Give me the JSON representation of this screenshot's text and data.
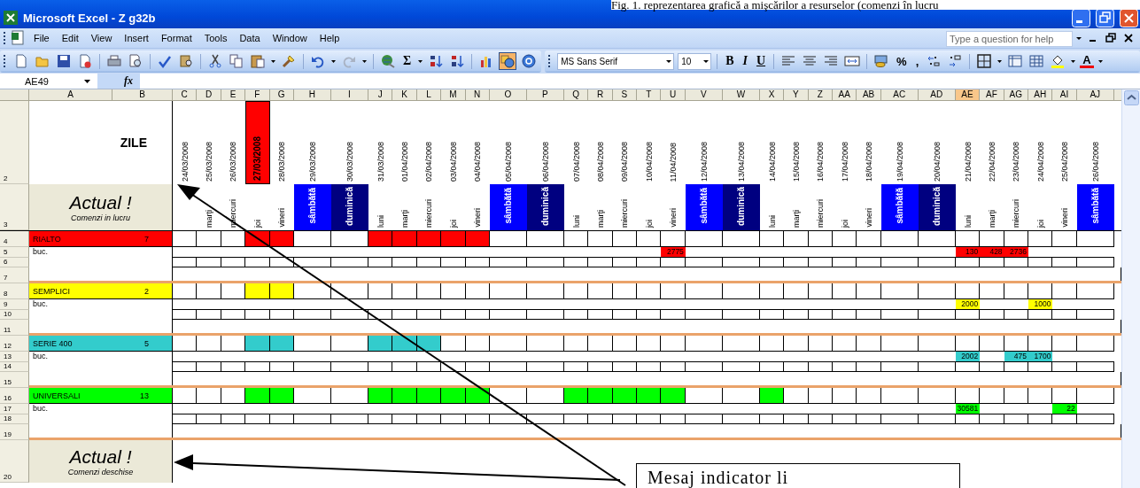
{
  "caption": "Fig. 1. reprezentarea grafică a  mişcărilor a resurselor (comenzi în lucru",
  "window": {
    "title": "Microsoft Excel - Z g32b"
  },
  "menu": [
    {
      "label": "File",
      "selected": false
    },
    {
      "label": "Edit",
      "selected": false
    },
    {
      "label": "View",
      "selected": false
    },
    {
      "label": "Insert",
      "selected": false
    },
    {
      "label": "Format",
      "selected": false
    },
    {
      "label": "Tools",
      "selected": false
    },
    {
      "label": "Data",
      "selected": false
    },
    {
      "label": "Window",
      "selected": false
    },
    {
      "label": "Help",
      "selected": false
    }
  ],
  "help_box": {
    "placeholder": "Type a question for help"
  },
  "toolbar": {
    "sum": "Σ",
    "bold": "B",
    "italic": "I",
    "underline": "U",
    "percent": "%",
    "comma": ",",
    "font_color": "A",
    "drawing_on": true
  },
  "font_box": {
    "value": "MS Sans Serif"
  },
  "size_box": {
    "value": "10"
  },
  "name_box": {
    "value": "AE49"
  },
  "formula_bar": {
    "label": "fx"
  },
  "columns": [
    {
      "label": "A",
      "selected": false
    },
    {
      "label": "B",
      "selected": false
    },
    {
      "label": "C",
      "selected": false
    },
    {
      "label": "D",
      "selected": false
    },
    {
      "label": "E",
      "selected": false
    },
    {
      "label": "F",
      "selected": false
    },
    {
      "label": "G",
      "selected": false
    },
    {
      "label": "H",
      "selected": false
    },
    {
      "label": "I",
      "selected": false
    },
    {
      "label": "J",
      "selected": false
    },
    {
      "label": "K",
      "selected": false
    },
    {
      "label": "L",
      "selected": false
    },
    {
      "label": "M",
      "selected": false
    },
    {
      "label": "N",
      "selected": false
    },
    {
      "label": "O",
      "selected": false
    },
    {
      "label": "P",
      "selected": false
    },
    {
      "label": "Q",
      "selected": false
    },
    {
      "label": "R",
      "selected": false
    },
    {
      "label": "S",
      "selected": false
    },
    {
      "label": "T",
      "selected": false
    },
    {
      "label": "U",
      "selected": false
    },
    {
      "label": "V",
      "selected": false
    },
    {
      "label": "W",
      "selected": false
    },
    {
      "label": "X",
      "selected": false
    },
    {
      "label": "Y",
      "selected": false
    },
    {
      "label": "Z",
      "selected": false
    },
    {
      "label": "AA",
      "selected": false
    },
    {
      "label": "AB",
      "selected": false
    },
    {
      "label": "AC",
      "selected": false
    },
    {
      "label": "AD",
      "selected": false
    },
    {
      "label": "AE",
      "selected": true
    },
    {
      "label": "AF",
      "selected": false
    },
    {
      "label": "AG",
      "selected": false
    },
    {
      "label": "AH",
      "selected": false
    },
    {
      "label": "AI",
      "selected": false
    },
    {
      "label": "AJ",
      "selected": false
    }
  ],
  "header": {
    "row_2": "2",
    "row_3": "3",
    "days_label": "ZILE",
    "title": "Actual !",
    "subtitle": "Comenzi in lucru"
  },
  "days": [
    {
      "date": "24/03/2008",
      "kind": "weekday",
      "today": false
    },
    {
      "date": "25/03/2008",
      "day": "marţi",
      "kind": "weekday",
      "today": false
    },
    {
      "date": "26/03/2008",
      "day": "miercuri",
      "kind": "weekday",
      "today": false
    },
    {
      "date": "27/03/2008",
      "day": "joi",
      "kind": "weekday",
      "today": true
    },
    {
      "date": "28/03/2008",
      "day": "vineri",
      "kind": "weekday",
      "today": false
    },
    {
      "date": "29/03/2008",
      "day": "sâmbătă",
      "kind": "saturday",
      "today": false
    },
    {
      "date": "30/03/2008",
      "day": "duminică",
      "kind": "sunday",
      "today": false
    },
    {
      "date": "31/03/2008",
      "day": "luni",
      "kind": "weekday",
      "today": false
    },
    {
      "date": "01/04/2008",
      "day": "marţi",
      "kind": "weekday",
      "today": false
    },
    {
      "date": "02/04/2008",
      "day": "miercuri",
      "kind": "weekday",
      "today": false
    },
    {
      "date": "03/04/2008",
      "day": "joi",
      "kind": "weekday",
      "today": false
    },
    {
      "date": "04/04/2008",
      "day": "vineri",
      "kind": "weekday",
      "today": false
    },
    {
      "date": "05/04/2008",
      "day": "sâmbătă",
      "kind": "saturday",
      "today": false
    },
    {
      "date": "06/04/2008",
      "day": "duminică",
      "kind": "sunday",
      "today": false
    },
    {
      "date": "07/04/2008",
      "day": "luni",
      "kind": "weekday",
      "today": false
    },
    {
      "date": "08/04/2008",
      "day": "marţi",
      "kind": "weekday",
      "today": false
    },
    {
      "date": "09/04/2008",
      "day": "miercuri",
      "kind": "weekday",
      "today": false
    },
    {
      "date": "10/04/2008",
      "day": "joi",
      "kind": "weekday",
      "today": false
    },
    {
      "date": "11/04/2008",
      "day": "vineri",
      "kind": "weekday",
      "today": false
    },
    {
      "date": "12/04/2008",
      "day": "sâmbătă",
      "kind": "saturday",
      "today": false
    },
    {
      "date": "13/04/2008",
      "day": "duminică",
      "kind": "sunday",
      "today": false
    },
    {
      "date": "14/04/2008",
      "day": "luni",
      "kind": "weekday",
      "today": false
    },
    {
      "date": "15/04/2008",
      "day": "marţi",
      "kind": "weekday",
      "today": false
    },
    {
      "date": "16/04/2008",
      "day": "miercuri",
      "kind": "weekday",
      "today": false
    },
    {
      "date": "17/04/2008",
      "day": "joi",
      "kind": "weekday",
      "today": false
    },
    {
      "date": "18/04/2008",
      "day": "vineri",
      "kind": "weekday",
      "today": false
    },
    {
      "date": "19/04/2008",
      "day": "sâmbătă",
      "kind": "saturday",
      "today": false
    },
    {
      "date": "20/04/2008",
      "day": "duminică",
      "kind": "sunday",
      "today": false
    },
    {
      "date": "21/04/2008",
      "day": "luni",
      "kind": "weekday",
      "today": false
    },
    {
      "date": "22/04/2008",
      "day": "marţi",
      "kind": "weekday",
      "today": false
    },
    {
      "date": "23/04/2008",
      "day": "miercuri",
      "kind": "weekday",
      "today": false
    },
    {
      "date": "24/04/2008",
      "day": "joi",
      "kind": "weekday",
      "today": false
    },
    {
      "date": "25/04/2008",
      "day": "vineri",
      "kind": "weekday",
      "today": false
    },
    {
      "date": "26/04/2008",
      "day": "sâmbătă",
      "kind": "saturday",
      "today": false
    }
  ],
  "groups": [
    {
      "rows": [
        "4",
        "5",
        "6",
        "7"
      ],
      "name": "RIALTO",
      "count": "7",
      "unit": "buc.",
      "color": "#ff0000",
      "cells": [
        {
          "busy": false
        },
        {
          "busy": false
        },
        {
          "busy": false
        },
        {
          "busy": true
        },
        {
          "busy": true
        },
        {
          "busy": false
        },
        {
          "busy": false
        },
        {
          "busy": true
        },
        {
          "busy": true
        },
        {
          "busy": true
        },
        {
          "busy": true
        },
        {
          "busy": true
        },
        {
          "busy": false
        },
        {
          "busy": false
        },
        {
          "busy": false
        },
        {
          "busy": false
        },
        {
          "busy": false
        },
        {
          "busy": false
        },
        {
          "busy": false,
          "quantity": "2775"
        },
        {
          "busy": false
        },
        {
          "busy": false
        },
        {
          "busy": false
        },
        {
          "busy": false
        },
        {
          "busy": false
        },
        {
          "busy": false
        },
        {
          "busy": false
        },
        {
          "busy": false
        },
        {
          "busy": false
        },
        {
          "busy": false,
          "quantity": "130"
        },
        {
          "busy": false,
          "quantity": "428"
        },
        {
          "busy": false,
          "quantity": "2736"
        },
        {
          "busy": false
        },
        {
          "busy": false
        },
        {
          "busy": false
        }
      ]
    },
    {
      "rows": [
        "8",
        "9",
        "10",
        "11"
      ],
      "name": "SEMPLICI",
      "count": "2",
      "unit": "buc.",
      "color": "#ffff00",
      "cells": [
        {
          "busy": false
        },
        {
          "busy": false
        },
        {
          "busy": false
        },
        {
          "busy": true
        },
        {
          "busy": true
        },
        {
          "busy": false
        },
        {
          "busy": false
        },
        {
          "busy": false
        },
        {
          "busy": false
        },
        {
          "busy": false
        },
        {
          "busy": false
        },
        {
          "busy": false
        },
        {
          "busy": false
        },
        {
          "busy": false
        },
        {
          "busy": false
        },
        {
          "busy": false
        },
        {
          "busy": false
        },
        {
          "busy": false
        },
        {
          "busy": false
        },
        {
          "busy": false
        },
        {
          "busy": false
        },
        {
          "busy": false
        },
        {
          "busy": false
        },
        {
          "busy": false
        },
        {
          "busy": false
        },
        {
          "busy": false
        },
        {
          "busy": false
        },
        {
          "busy": false
        },
        {
          "busy": false,
          "quantity": "2000"
        },
        {
          "busy": false
        },
        {
          "busy": false
        },
        {
          "busy": false,
          "quantity": "1000"
        },
        {
          "busy": false
        },
        {
          "busy": false
        }
      ]
    },
    {
      "rows": [
        "12",
        "13",
        "14",
        "15"
      ],
      "name": "SERIE 400",
      "count": "5",
      "unit": "buc.",
      "color": "#33cccc",
      "cells": [
        {
          "busy": false
        },
        {
          "busy": false
        },
        {
          "busy": false
        },
        {
          "busy": true
        },
        {
          "busy": true
        },
        {
          "busy": false
        },
        {
          "busy": false
        },
        {
          "busy": true
        },
        {
          "busy": true
        },
        {
          "busy": true
        },
        {
          "busy": false
        },
        {
          "busy": false
        },
        {
          "busy": false
        },
        {
          "busy": false
        },
        {
          "busy": false
        },
        {
          "busy": false
        },
        {
          "busy": false
        },
        {
          "busy": false
        },
        {
          "busy": false
        },
        {
          "busy": false
        },
        {
          "busy": false
        },
        {
          "busy": false
        },
        {
          "busy": false
        },
        {
          "busy": false
        },
        {
          "busy": false
        },
        {
          "busy": false
        },
        {
          "busy": false
        },
        {
          "busy": false
        },
        {
          "busy": false,
          "quantity": "2002"
        },
        {
          "busy": false
        },
        {
          "busy": false,
          "quantity": "475"
        },
        {
          "busy": false,
          "quantity": "1700"
        },
        {
          "busy": false
        },
        {
          "busy": false
        }
      ]
    },
    {
      "rows": [
        "16",
        "17",
        "18",
        "19"
      ],
      "name": "UNIVERSALI",
      "count": "13",
      "unit": "buc.",
      "color": "#00ff00",
      "cells": [
        {
          "busy": false
        },
        {
          "busy": false
        },
        {
          "busy": false
        },
        {
          "busy": true
        },
        {
          "busy": true
        },
        {
          "busy": false
        },
        {
          "busy": false
        },
        {
          "busy": true
        },
        {
          "busy": true
        },
        {
          "busy": true
        },
        {
          "busy": true
        },
        {
          "busy": true
        },
        {
          "busy": false
        },
        {
          "busy": false
        },
        {
          "busy": true
        },
        {
          "busy": true
        },
        {
          "busy": true
        },
        {
          "busy": true
        },
        {
          "busy": true
        },
        {
          "busy": false
        },
        {
          "busy": false
        },
        {
          "busy": true
        },
        {
          "busy": false
        },
        {
          "busy": false
        },
        {
          "busy": false
        },
        {
          "busy": false
        },
        {
          "busy": false
        },
        {
          "busy": false
        },
        {
          "busy": false,
          "quantity": "30581"
        },
        {
          "busy": false
        },
        {
          "busy": false
        },
        {
          "busy": false
        },
        {
          "busy": false,
          "quantity": "22"
        },
        {
          "busy": false
        }
      ]
    }
  ],
  "footer": {
    "row": "20",
    "title": "Actual !",
    "subtitle": "Comenzi deschise"
  },
  "callout": {
    "text": "Mesaj indicator li"
  }
}
